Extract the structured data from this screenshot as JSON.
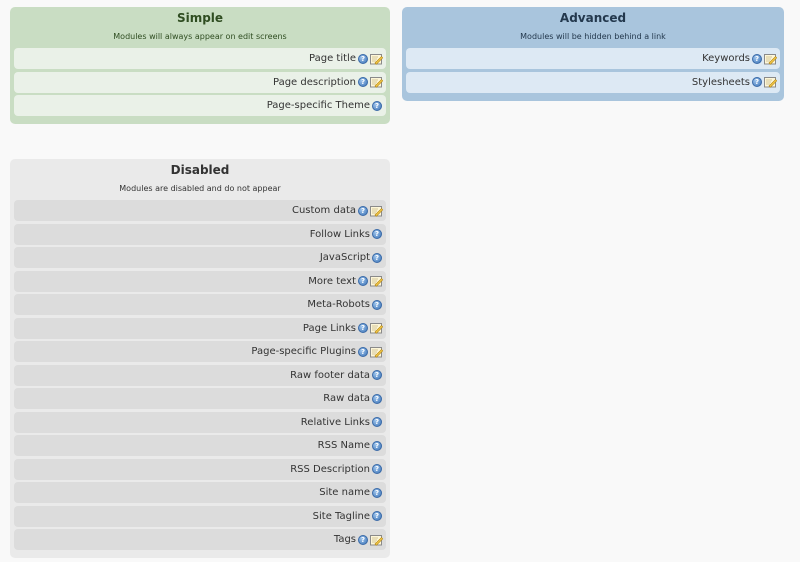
{
  "simple": {
    "title": "Simple",
    "description": "Modules will always appear on edit screens",
    "items": [
      {
        "label": "Page title",
        "editable": true
      },
      {
        "label": "Page description",
        "editable": true
      },
      {
        "label": "Page-specific Theme",
        "editable": false
      }
    ]
  },
  "advanced": {
    "title": "Advanced",
    "description": "Modules will be hidden behind a link",
    "items": [
      {
        "label": "Keywords",
        "editable": true
      },
      {
        "label": "Stylesheets",
        "editable": true
      }
    ]
  },
  "disabled": {
    "title": "Disabled",
    "description": "Modules are disabled and do not appear",
    "items": [
      {
        "label": "Custom data",
        "editable": true
      },
      {
        "label": "Follow Links",
        "editable": false
      },
      {
        "label": "JavaScript",
        "editable": false
      },
      {
        "label": "More text",
        "editable": true
      },
      {
        "label": "Meta-Robots",
        "editable": false
      },
      {
        "label": "Page Links",
        "editable": true
      },
      {
        "label": "Page-specific Plugins",
        "editable": true
      },
      {
        "label": "Raw footer data",
        "editable": false
      },
      {
        "label": "Raw data",
        "editable": false
      },
      {
        "label": "Relative Links",
        "editable": false
      },
      {
        "label": "RSS Name",
        "editable": false
      },
      {
        "label": "RSS Description",
        "editable": false
      },
      {
        "label": "Site name",
        "editable": false
      },
      {
        "label": "Site Tagline",
        "editable": false
      },
      {
        "label": "Tags",
        "editable": true
      }
    ]
  },
  "icons": {
    "help": "help-icon",
    "edit": "edit-icon"
  },
  "colors": {
    "simple_bg": "#c9ddc3",
    "advanced_bg": "#a9c5dd",
    "disabled_bg": "#eaeaea"
  }
}
